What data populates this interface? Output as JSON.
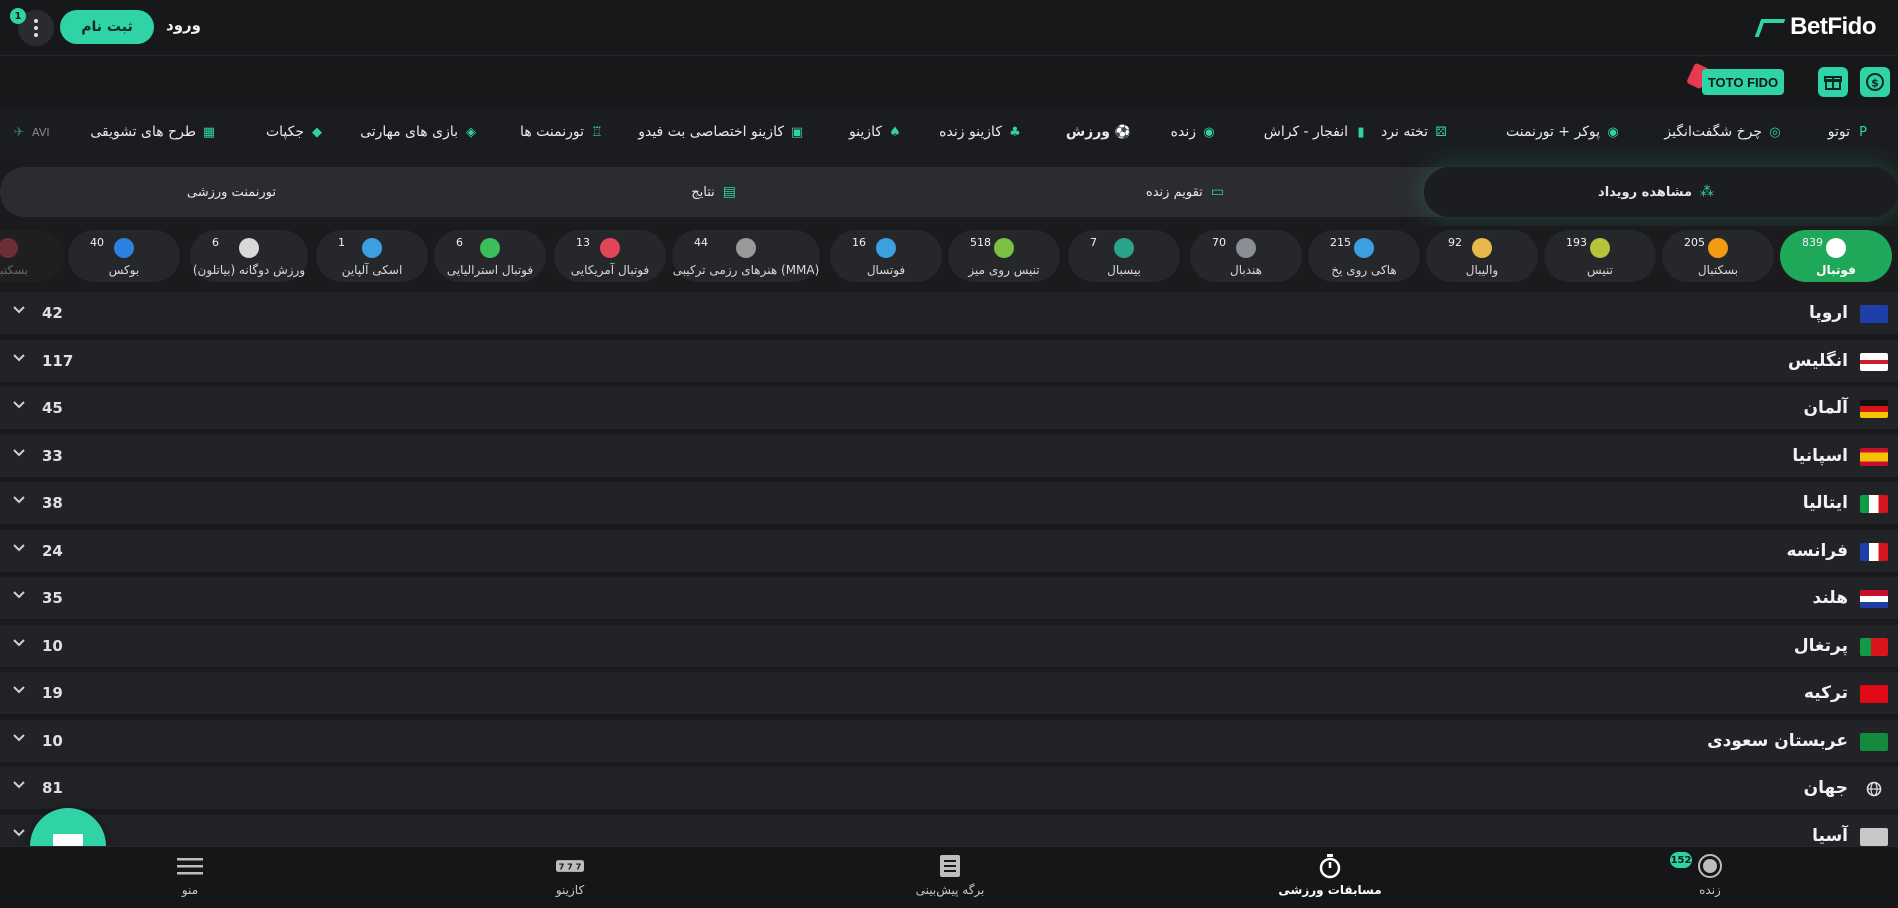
{
  "header": {
    "brand": "BetFido",
    "register_label": "ثبت نام",
    "login_label": "ورود",
    "notification_count": "1"
  },
  "promo": {
    "toto_fido_label": "TOTO FIDO"
  },
  "nav": {
    "items": [
      {
        "label": "توتو",
        "icon": "toto-icon"
      },
      {
        "label": "چرخ شگفت‌انگیز",
        "icon": "wheel-icon"
      },
      {
        "label": "پوکر + تورنمنت",
        "icon": "poker-icon"
      },
      {
        "label": "تخته نرد",
        "icon": "dice-icon"
      },
      {
        "label": "انفجار - کراش",
        "icon": "crash-chart-icon"
      },
      {
        "label": "زنده",
        "icon": "live-icon"
      },
      {
        "label": "ورزش",
        "icon": "soccer-ball-icon",
        "active": true
      },
      {
        "label": "کازینو زنده",
        "icon": "dealer-icon"
      },
      {
        "label": "کازینو",
        "icon": "casino-icon"
      },
      {
        "label": "کازینو اختصاصی بت فیدو",
        "icon": "video-icon"
      },
      {
        "label": "تورنمنت ها",
        "icon": "trophy-icon"
      },
      {
        "label": "بازی های مهارتی",
        "icon": "skill-game-icon"
      },
      {
        "label": "جکپات",
        "icon": "diamond-icon"
      },
      {
        "label": "طرح های تشویقی",
        "icon": "gift-icon"
      },
      {
        "label": "AVI",
        "icon": "plane-icon"
      }
    ]
  },
  "tabs": {
    "items": [
      {
        "label": "مشاهده رویداد",
        "active": true
      },
      {
        "label": "تقویم زنده"
      },
      {
        "label": "نتایج"
      },
      {
        "label": "تورنمنت ورزشی"
      }
    ]
  },
  "sports": [
    {
      "label": "فوتبال",
      "count": "839",
      "active": true,
      "color": "#ffffff"
    },
    {
      "label": "بسکتبال",
      "count": "205",
      "color": "#f39c12"
    },
    {
      "label": "تنیس",
      "count": "193",
      "color": "#b8c23a"
    },
    {
      "label": "والیبال",
      "count": "92",
      "color": "#e8b84a"
    },
    {
      "label": "هاکی روی یخ",
      "count": "215",
      "color": "#3aa0e0"
    },
    {
      "label": "هندبال",
      "count": "70",
      "color": "#8a8f96"
    },
    {
      "label": "بیسبال",
      "count": "7",
      "color": "#2aa58a"
    },
    {
      "label": "تنیس روی میز",
      "count": "518",
      "color": "#7bc043"
    },
    {
      "label": "فوتسال",
      "count": "16",
      "color": "#3aa0e0"
    },
    {
      "label": "هنرهای رزمی ترکیبی (MMA)",
      "count": "44",
      "color": "#9a9a9a"
    },
    {
      "label": "فوتبال آمریکایی",
      "count": "13",
      "color": "#e0485a"
    },
    {
      "label": "فوتبال استرالیایی",
      "count": "6",
      "color": "#3bbf5c"
    },
    {
      "label": "اسکی آلپاین",
      "count": "1",
      "color": "#3aa0e0"
    },
    {
      "label": "ورزش دوگانه (بیاتلون)",
      "count": "6",
      "color": "#d8d8d8"
    },
    {
      "label": "بوکس",
      "count": "40",
      "color": "#2d7fe0"
    },
    {
      "label": "بسکتبال",
      "count": "",
      "color": "#e0485a"
    }
  ],
  "leagues": [
    {
      "name": "اروپا",
      "count": "42",
      "flag": "eu"
    },
    {
      "name": "انگلیس",
      "count": "117",
      "flag": "en"
    },
    {
      "name": "آلمان",
      "count": "45",
      "flag": "de"
    },
    {
      "name": "اسپانیا",
      "count": "33",
      "flag": "es"
    },
    {
      "name": "ایتالیا",
      "count": "38",
      "flag": "it"
    },
    {
      "name": "فرانسه",
      "count": "24",
      "flag": "fr"
    },
    {
      "name": "هلند",
      "count": "35",
      "flag": "nl"
    },
    {
      "name": "پرتغال",
      "count": "10",
      "flag": "pt"
    },
    {
      "name": "ترکیه",
      "count": "19",
      "flag": "tr"
    },
    {
      "name": "عربستان سعودی",
      "count": "10",
      "flag": "sa"
    },
    {
      "name": "جهان",
      "count": "81",
      "flag": "world"
    },
    {
      "name": "آسیا",
      "count": "",
      "flag": "asia"
    }
  ],
  "bottom_nav": {
    "items": [
      {
        "label": "منو",
        "icon": "hamburger-icon"
      },
      {
        "label": "کازینو",
        "icon": "slot-777-icon"
      },
      {
        "label": "برگه پیش‌بینی",
        "icon": "betslip-icon"
      },
      {
        "label": "مسابقات ورزشی",
        "icon": "stopwatch-icon",
        "active": true
      },
      {
        "label": "زنده",
        "icon": "live-record-icon"
      }
    ],
    "live_count": "152"
  },
  "colors": {
    "accent": "#2fd3a6",
    "active_sport": "#1fa75a",
    "background": "#1b1b1d"
  }
}
